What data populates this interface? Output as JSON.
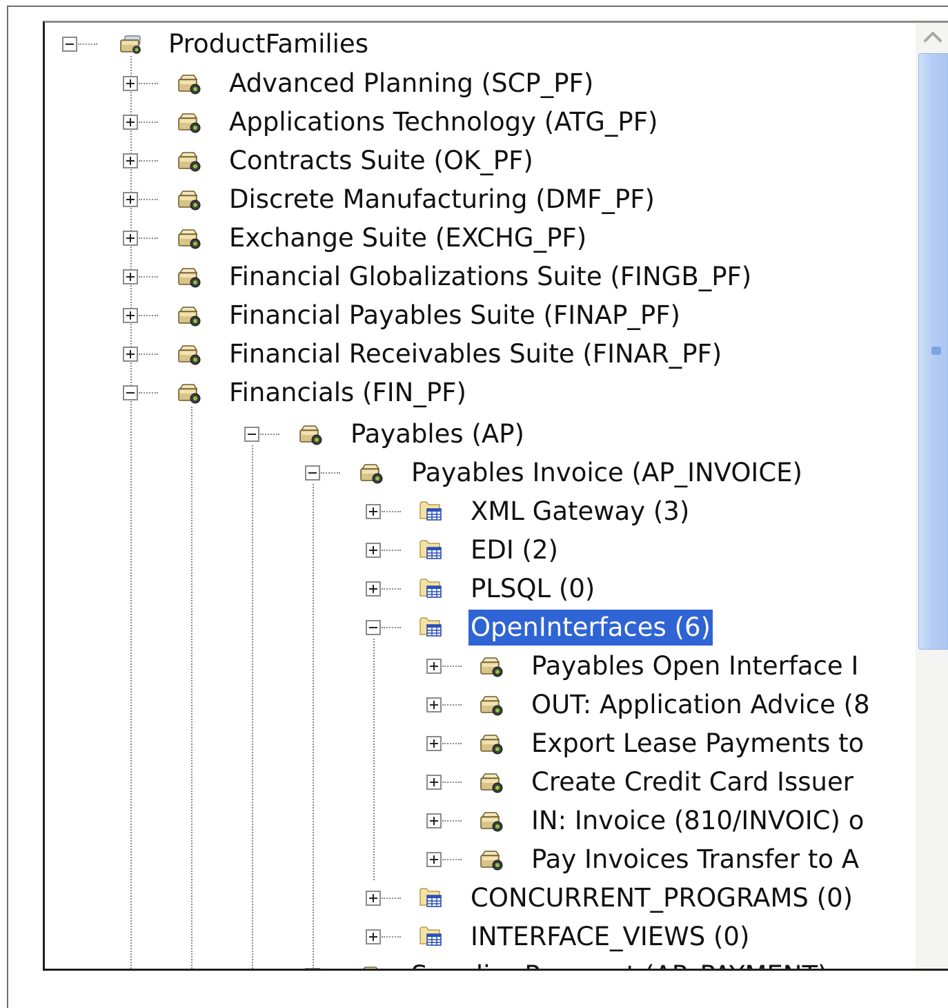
{
  "root": {
    "label": "ProductFamilies",
    "icon": "folder-group-icon"
  },
  "product_families": [
    {
      "label": "Advanced Planning (SCP_PF)"
    },
    {
      "label": "Applications Technology (ATG_PF)"
    },
    {
      "label": "Contracts Suite (OK_PF)"
    },
    {
      "label": "Discrete Manufacturing (DMF_PF)"
    },
    {
      "label": "Exchange Suite (EXCHG_PF)"
    },
    {
      "label": "Financial Globalizations Suite (FINGB_PF)"
    },
    {
      "label": "Financial Payables Suite (FINAP_PF)"
    },
    {
      "label": "Financial Receivables Suite (FINAR_PF)"
    },
    {
      "label": "Financials (FIN_PF)"
    }
  ],
  "payables": {
    "label": "Payables (AP)"
  },
  "payables_invoice": {
    "label": "Payables Invoice (AP_INVOICE)"
  },
  "interface_groups": [
    {
      "label": "XML Gateway (3)"
    },
    {
      "label": "EDI (2)"
    },
    {
      "label": "PLSQL (0)"
    },
    {
      "label": "OpenInterfaces (6)",
      "selected": true
    }
  ],
  "open_interfaces": [
    {
      "label": "Payables Open Interface I"
    },
    {
      "label": "OUT: Application Advice (8"
    },
    {
      "label": "Export Lease Payments to"
    },
    {
      "label": "Create Credit Card Issuer"
    },
    {
      "label": "IN: Invoice (810/INVOIC) o"
    },
    {
      "label": "Pay Invoices Transfer to A"
    }
  ],
  "trailing_groups": [
    {
      "label": "CONCURRENT_PROGRAMS (0)"
    },
    {
      "label": "INTERFACE_VIEWS (0)"
    }
  ],
  "supplier_payment": {
    "label": "Supplier Payment (AP_PAYMENT)"
  },
  "colors": {
    "selection": "#2f64d4",
    "folder": "#e9d9a6",
    "table_grid": "#2a4fbf",
    "scroll_thumb": "#b7cef5"
  },
  "icons": {
    "product_node": "folder-gear-icon",
    "group_node": "folder-table-icon",
    "expand": "plus-box-icon",
    "collapse": "minus-box-icon"
  }
}
